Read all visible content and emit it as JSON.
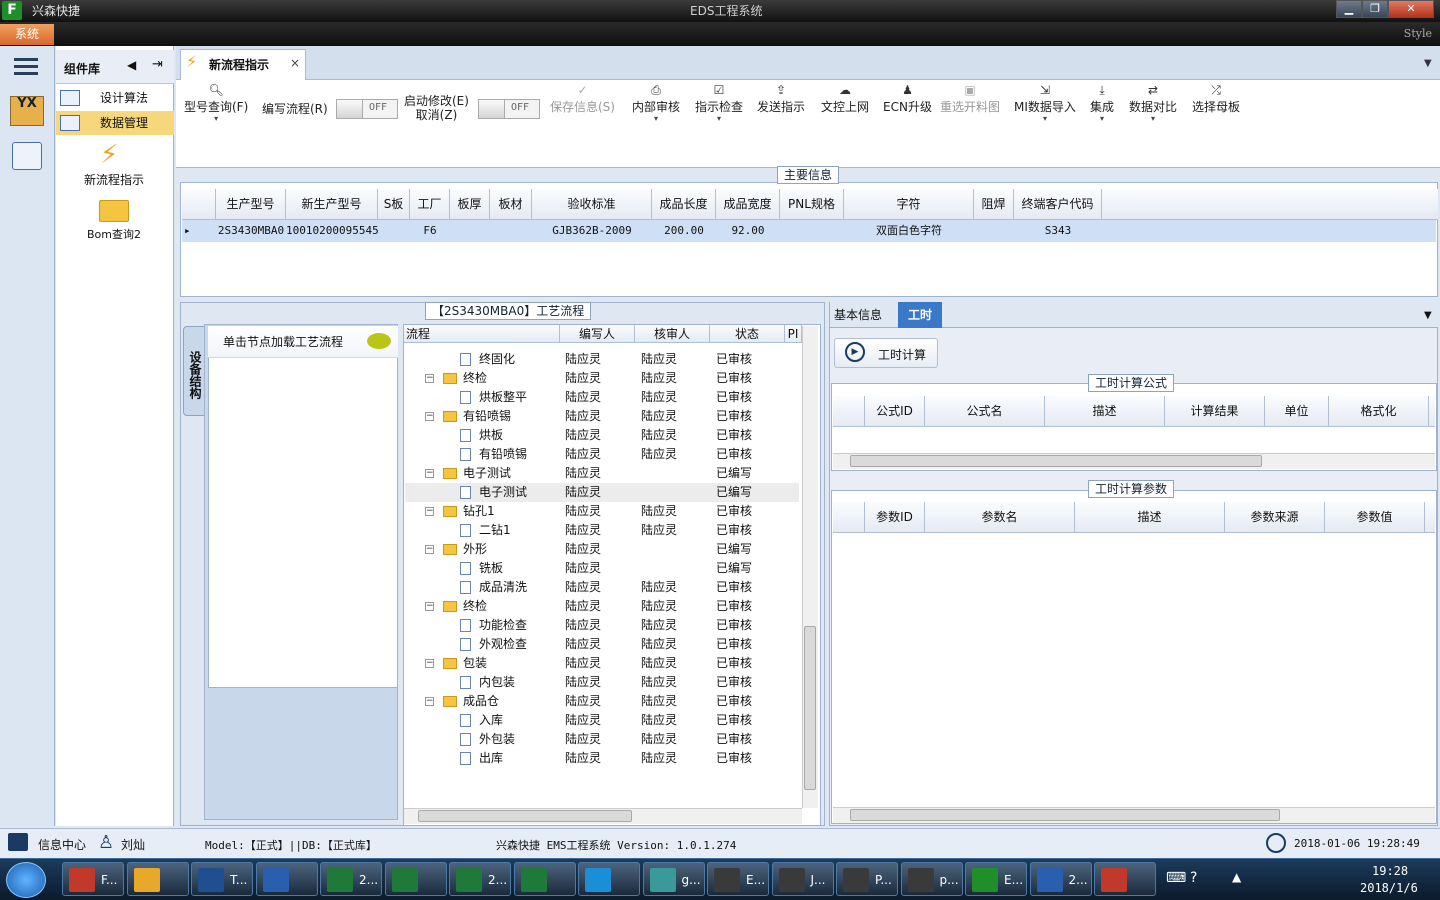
{
  "titlebar": {
    "app_name": "兴森快捷",
    "window_title": "EDS工程系统",
    "minimize": "▁",
    "restore": "❐",
    "close": "✕"
  },
  "ribbon": {
    "system_tab": "系统",
    "style_label": "Style"
  },
  "component_panel": {
    "title": "组件库",
    "items": [
      {
        "label": "设计算法"
      },
      {
        "label": "数据管理"
      }
    ],
    "big_items": [
      {
        "label": "新流程指示"
      },
      {
        "label": "Bom查询2"
      }
    ]
  },
  "doc_tab": {
    "label": "新流程指示",
    "close": "×"
  },
  "toolbar": {
    "buttons": [
      {
        "label": "型号查询(F)"
      },
      {
        "label": "编写流程(R)"
      },
      {
        "label": "启动修改(E)"
      },
      {
        "label": "取消(Z)"
      },
      {
        "label": "保存信息(S)"
      },
      {
        "label": "内部审核"
      },
      {
        "label": "指示检查"
      },
      {
        "label": "发送指示"
      },
      {
        "label": "文控上网"
      },
      {
        "label": "ECN升级"
      },
      {
        "label": "重选开料图"
      },
      {
        "label": "MI数据导入"
      },
      {
        "label": "集成"
      },
      {
        "label": "数据对比"
      },
      {
        "label": "选择母板"
      }
    ],
    "toggle1": "OFF",
    "toggle2": "OFF"
  },
  "main_info": {
    "legend": "主要信息",
    "columns": [
      "生产型号",
      "新生产型号",
      "S板",
      "工厂",
      "板厚",
      "板材",
      "验收标准",
      "成品长度",
      "成品宽度",
      "PNL规格",
      "字符",
      "阻焊",
      "终端客户代码"
    ],
    "row": [
      "2S3430MBA0",
      "10010200095545",
      "",
      "F6",
      "",
      "",
      "GJB362B-2009",
      "200.00",
      "92.00",
      "",
      "双面白色字符",
      "",
      "S343"
    ]
  },
  "process_panel": {
    "legend": "【2S3430MBA0】工艺流程",
    "side_tab": "设备结构",
    "hint": "单击节点加载工艺流程",
    "columns": [
      "流程",
      "编写人",
      "核审人",
      "状态",
      "PI"
    ],
    "rows": [
      {
        "name": "终固化",
        "level": 2,
        "writer": "陆应灵",
        "reviewer": "陆应灵",
        "status": "已审核"
      },
      {
        "name": "终检",
        "level": 1,
        "writer": "陆应灵",
        "reviewer": "陆应灵",
        "status": "已审核"
      },
      {
        "name": "烘板整平",
        "level": 2,
        "writer": "陆应灵",
        "reviewer": "陆应灵",
        "status": "已审核"
      },
      {
        "name": "有铅喷锡",
        "level": 1,
        "writer": "陆应灵",
        "reviewer": "陆应灵",
        "status": "已审核"
      },
      {
        "name": "烘板",
        "level": 2,
        "writer": "陆应灵",
        "reviewer": "陆应灵",
        "status": "已审核"
      },
      {
        "name": "有铅喷锡",
        "level": 2,
        "writer": "陆应灵",
        "reviewer": "陆应灵",
        "status": "已审核"
      },
      {
        "name": "电子测试",
        "level": 1,
        "writer": "陆应灵",
        "reviewer": "",
        "status": "已编写"
      },
      {
        "name": "电子测试",
        "level": 2,
        "writer": "陆应灵",
        "reviewer": "",
        "status": "已编写"
      },
      {
        "name": "钻孔1",
        "level": 1,
        "writer": "陆应灵",
        "reviewer": "陆应灵",
        "status": "已审核"
      },
      {
        "name": "二钻1",
        "level": 2,
        "writer": "陆应灵",
        "reviewer": "陆应灵",
        "status": "已审核"
      },
      {
        "name": "外形",
        "level": 1,
        "writer": "陆应灵",
        "reviewer": "",
        "status": "已编写"
      },
      {
        "name": "铣板",
        "level": 2,
        "writer": "陆应灵",
        "reviewer": "",
        "status": "已编写"
      },
      {
        "name": "成品清洗",
        "level": 2,
        "writer": "陆应灵",
        "reviewer": "陆应灵",
        "status": "已审核"
      },
      {
        "name": "终检",
        "level": 1,
        "writer": "陆应灵",
        "reviewer": "陆应灵",
        "status": "已审核"
      },
      {
        "name": "功能检查",
        "level": 2,
        "writer": "陆应灵",
        "reviewer": "陆应灵",
        "status": "已审核"
      },
      {
        "name": "外观检查",
        "level": 2,
        "writer": "陆应灵",
        "reviewer": "陆应灵",
        "status": "已审核"
      },
      {
        "name": "包装",
        "level": 1,
        "writer": "陆应灵",
        "reviewer": "陆应灵",
        "status": "已审核"
      },
      {
        "name": "内包装",
        "level": 2,
        "writer": "陆应灵",
        "reviewer": "陆应灵",
        "status": "已审核"
      },
      {
        "name": "成品仓",
        "level": 1,
        "writer": "陆应灵",
        "reviewer": "陆应灵",
        "status": "已审核"
      },
      {
        "name": "入库",
        "level": 2,
        "writer": "陆应灵",
        "reviewer": "陆应灵",
        "status": "已审核"
      },
      {
        "name": "外包装",
        "level": 2,
        "writer": "陆应灵",
        "reviewer": "陆应灵",
        "status": "已审核"
      },
      {
        "name": "出库",
        "level": 2,
        "writer": "陆应灵",
        "reviewer": "陆应灵",
        "status": "已审核"
      }
    ]
  },
  "right_panel": {
    "tabs": [
      "基本信息",
      "工时"
    ],
    "calc_button": "工时计算",
    "formula": {
      "legend": "工时计算公式",
      "columns": [
        "公式ID",
        "公式名",
        "描述",
        "计算结果",
        "单位",
        "格式化"
      ]
    },
    "params": {
      "legend": "工时计算参数",
      "columns": [
        "参数ID",
        "参数名",
        "描述",
        "参数来源",
        "参数值"
      ]
    }
  },
  "statusbar": {
    "info_center": "信息中心",
    "user": "刘灿",
    "model": "Model:【正式】||DB:【正式库】",
    "version": "兴森快捷 EMS工程系统 Version: 1.0.1.274",
    "datetime": "2018-01-06 19:28:49"
  },
  "taskbar": {
    "tasks": [
      "F...",
      "",
      "T...",
      "",
      "2...",
      "",
      "2...",
      "",
      "",
      "g...",
      "E...",
      "J...",
      "P...",
      "p...",
      "E...",
      "2...",
      ""
    ],
    "time": "19:28",
    "date": "2018/1/6"
  }
}
